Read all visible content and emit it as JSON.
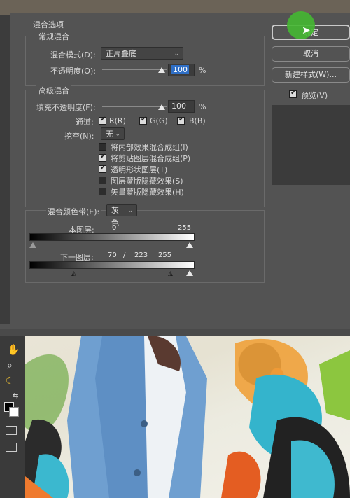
{
  "dialog": {
    "blend_options_title": "混合选项",
    "general": {
      "title": "常规混合",
      "mode_label": "混合模式(D):",
      "mode_value": "正片叠底",
      "opacity_label": "不透明度(O):",
      "opacity_value": "100",
      "opacity_unit": "%",
      "opacity_level": 1.0
    },
    "advanced": {
      "title": "高级混合",
      "fill_label": "填充不透明度(F):",
      "fill_value": "100",
      "fill_unit": "%",
      "fill_level": 1.0,
      "channels_label": "通道:",
      "channel_r": "R(R)",
      "channel_g": "G(G)",
      "channel_b": "B(B)",
      "knockout_label": "挖空(N):",
      "knockout_value": "无",
      "options": [
        {
          "label": "将内部效果混合成组(I)",
          "checked": false
        },
        {
          "label": "将剪贴图层混合成组(P)",
          "checked": true
        },
        {
          "label": "透明形状图层(T)",
          "checked": true
        },
        {
          "label": "图层蒙版隐藏效果(S)",
          "checked": false
        },
        {
          "label": "矢量蒙版隐藏效果(H)",
          "checked": false
        }
      ]
    },
    "blend_if": {
      "label": "混合颜色带(E):",
      "value": "灰色",
      "this_layer_label": "本图层:",
      "this_layer_low": "0",
      "this_layer_high": "255",
      "underlying_label": "下一图层:",
      "underlying_low": "70",
      "underlying_sep": "/",
      "underlying_mid": "223",
      "underlying_high": "255"
    },
    "buttons": {
      "ok": "确定",
      "cancel": "取消",
      "new_style": "新建样式(W)...",
      "preview": "预览(V)"
    }
  },
  "icons": [
    "hand-icon",
    "zoom-icon",
    "banana-icon",
    "swap-colors-icon",
    "foreground-color",
    "background-color",
    "quick-mask-icon",
    "screen-mode-icon"
  ],
  "colors": {
    "panel": "#535353",
    "accent_green": "#4fbf3a",
    "highlight_blue": "#2f6fc6"
  }
}
